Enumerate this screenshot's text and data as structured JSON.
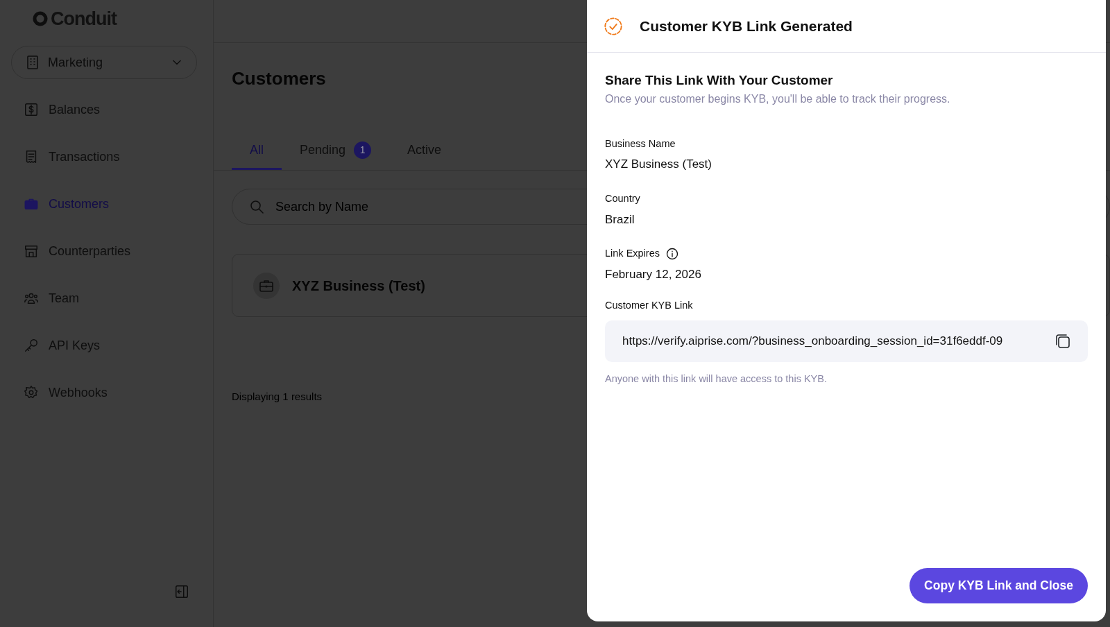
{
  "sidebar": {
    "logo": "Conduit",
    "workspace": "Marketing",
    "items": [
      {
        "label": "Balances",
        "selected": false
      },
      {
        "label": "Transactions",
        "selected": false
      },
      {
        "label": "Customers",
        "selected": true
      },
      {
        "label": "Counterparties",
        "selected": false
      },
      {
        "label": "Team",
        "selected": false
      },
      {
        "label": "API Keys",
        "selected": false
      },
      {
        "label": "Webhooks",
        "selected": false
      }
    ]
  },
  "page": {
    "title": "Customers",
    "tabs": [
      {
        "label": "All",
        "selected": true
      },
      {
        "label": "Pending",
        "selected": false,
        "count": "1"
      },
      {
        "label": "Active",
        "selected": false
      }
    ],
    "search": {
      "placeholder": "Search by Name"
    },
    "customers": [
      {
        "name": "XYZ Business (Test)"
      }
    ],
    "results": "Displaying 1 results"
  },
  "drawer": {
    "title": "Customer KYB Link Generated",
    "heading": "Share This Link With Your Customer",
    "subheading": "Once your customer begins KYB, you'll be able to track their progress.",
    "fields": [
      {
        "label": "Business Name",
        "value": "XYZ Business (Test)",
        "info": false
      },
      {
        "label": "Country",
        "value": "Brazil",
        "info": false
      },
      {
        "label": "Link Expires",
        "value": "February 12, 2026",
        "info": true
      }
    ],
    "link_label": "Customer KYB Link",
    "link": "https://verify.aiprise.com/?business_onboarding_session_id=31f6eddf-09",
    "link_note": "Anyone with this link will have access to this KYB.",
    "button": "Copy KYB Link and Close"
  }
}
